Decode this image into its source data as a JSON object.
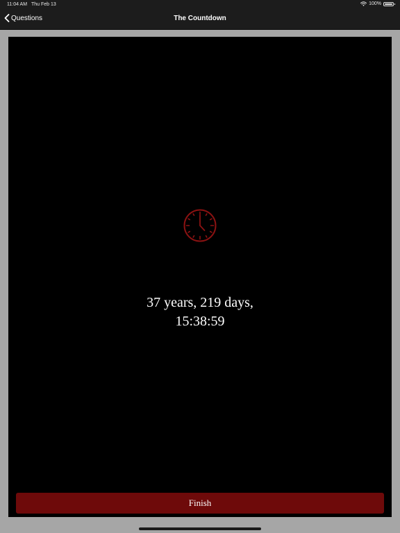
{
  "status_bar": {
    "time": "11:04 AM",
    "date": "Thu Feb 13",
    "battery": "100%"
  },
  "nav": {
    "back_label": "Questions",
    "title": "The Countdown"
  },
  "countdown": {
    "line1": "37 years, 219 days,",
    "line2": "15:38:59"
  },
  "finish_label": "Finish",
  "icons": {
    "clock": "clock-icon",
    "back": "chevron-left-icon",
    "wifi": "wifi-icon",
    "battery": "battery-icon"
  },
  "colors": {
    "accent": "#6e0a0a",
    "clock": "#8b1212",
    "background": "#000000",
    "navbar": "#1c1c1c"
  }
}
